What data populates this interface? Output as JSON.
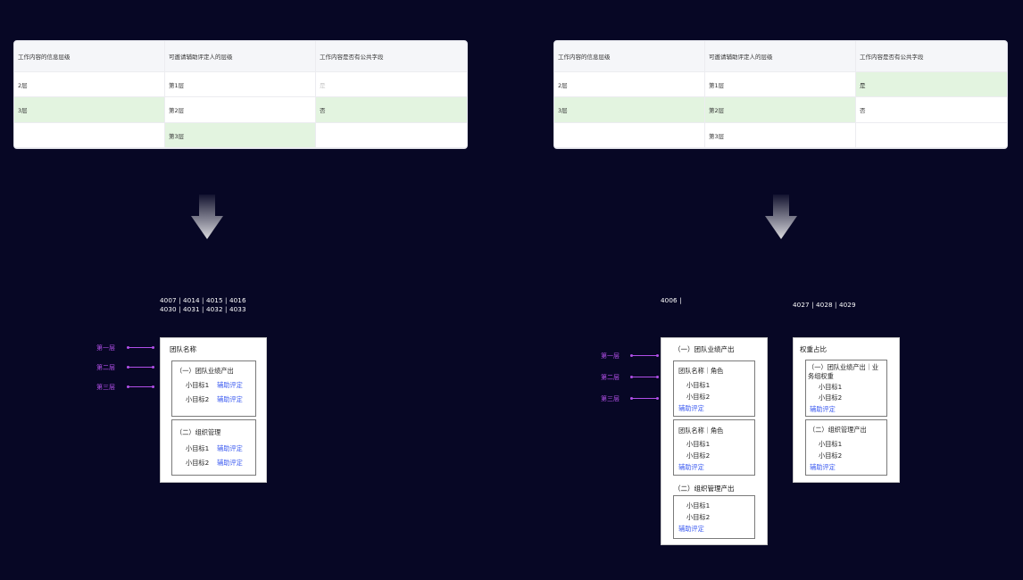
{
  "left_table": {
    "headers": [
      "工作内容的信息层级",
      "可邀请辅助评定人的层级",
      "工作内容是否有公共字段"
    ],
    "rows": [
      [
        "2层",
        "第1层",
        "是"
      ],
      [
        "3层",
        "第2层",
        "否"
      ],
      [
        "",
        "第3层",
        ""
      ]
    ]
  },
  "right_table": {
    "headers": [
      "工作内容的信息层级",
      "可邀请辅助评定人的层级",
      "工作内容是否有公共字段"
    ],
    "rows": [
      [
        "2层",
        "第1层",
        "是"
      ],
      [
        "3层",
        "第2层",
        "否"
      ],
      [
        "",
        "第3层",
        ""
      ]
    ]
  },
  "levels": [
    "第一层",
    "第二层",
    "第三层"
  ],
  "left_codes": [
    "4007 | 4014 | 4015 | 4016",
    "4030 | 4031 | 4032 | 4033"
  ],
  "mid_code": "4006 |",
  "right_code": "4027 | 4028 | 4029",
  "card1": {
    "title": "团队名称",
    "group1": "（一）团队业绩产出",
    "group2": "（二）组织管理",
    "item1": "小目标1",
    "item2": "小目标2",
    "assist": "辅助评定"
  },
  "card2": {
    "title": "（一）团队业绩产出",
    "team_role": "团队名称｜角色",
    "item1": "小目标1",
    "item2": "小目标2",
    "assist": "辅助评定",
    "group2": "（二）组织管理产出"
  },
  "card3": {
    "title": "权重占比",
    "group1_line1": "（一）团队业绩产出｜业",
    "group1_line2": "务组权重",
    "group2": "（二）组织管理产出",
    "item1": "小目标1",
    "item2": "小目标2",
    "assist": "辅助评定"
  },
  "colors": {
    "background": "#070725",
    "level_purple": "#b14fe8",
    "assist_blue": "#3d5cf0",
    "highlight_green": "#e3f4e0"
  }
}
